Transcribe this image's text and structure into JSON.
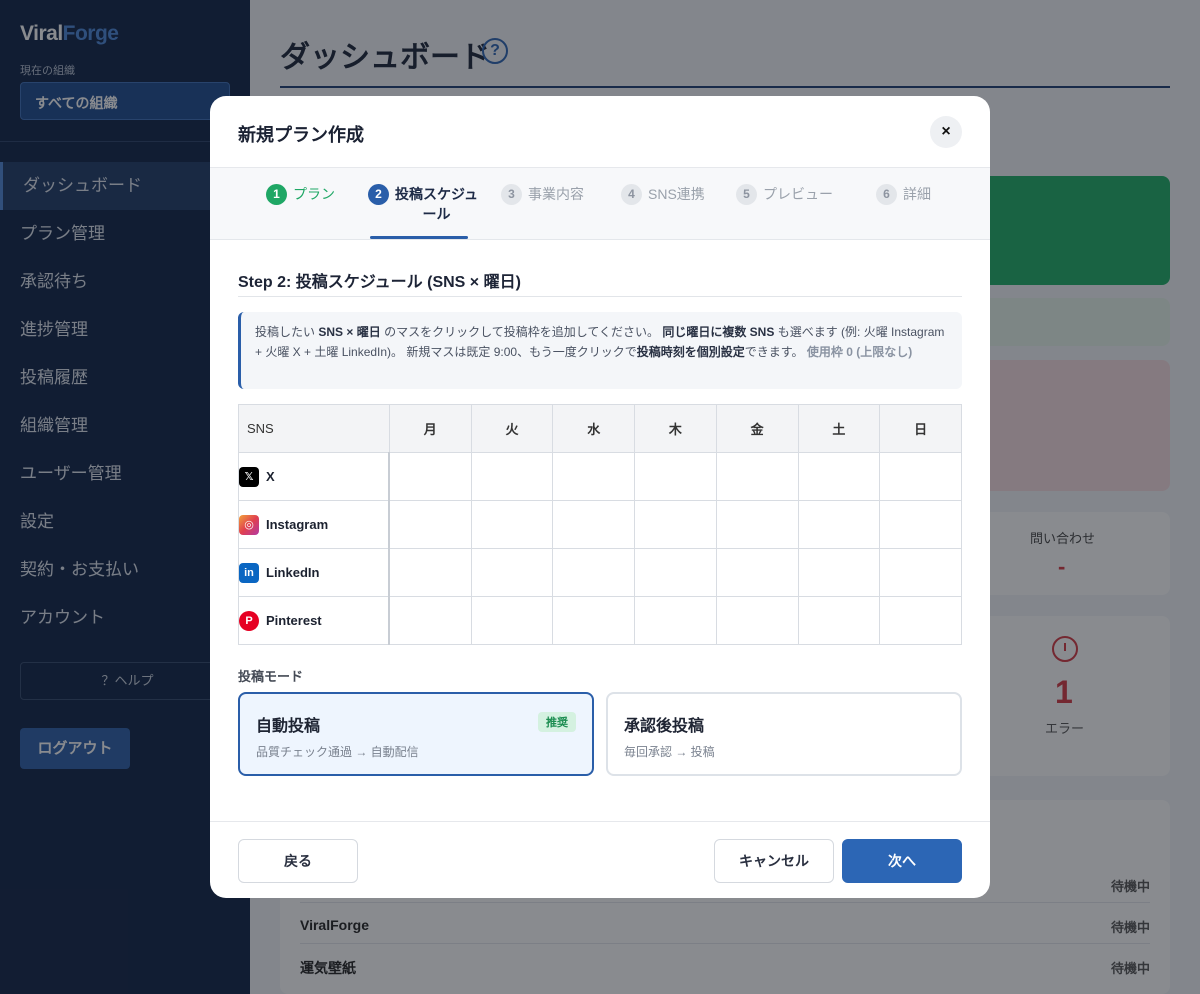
{
  "sidebar": {
    "logo_part1": "Viral",
    "logo_part2": "Forge",
    "org_label": "現在の組織",
    "org_value": "すべての組織",
    "items": [
      {
        "label": "ダッシュボード"
      },
      {
        "label": "プラン管理"
      },
      {
        "label": "承認待ち"
      },
      {
        "label": "進捗管理"
      },
      {
        "label": "投稿履歴"
      },
      {
        "label": "組織管理"
      },
      {
        "label": "ユーザー管理"
      },
      {
        "label": "設定"
      },
      {
        "label": "契約・お支払い"
      },
      {
        "label": "アカウント"
      }
    ],
    "help": "？ヘルプ",
    "logout": "ログアウト"
  },
  "main": {
    "title": "ダッシュボード",
    "help_icon": "?",
    "inquiry_label": "問い合わせ",
    "inquiry_value": "-",
    "error_count": "1",
    "error_label": "エラー",
    "rows": [
      {
        "name": "",
        "status": "待機中"
      },
      {
        "name": "ViralForge",
        "status": "待機中"
      },
      {
        "name": "運気壁紙",
        "status": "待機中"
      }
    ]
  },
  "modal": {
    "title": "新規プラン作成",
    "close": "×",
    "steps": [
      {
        "num": "1",
        "label": "プラン"
      },
      {
        "num": "2",
        "label": "投稿スケジュ",
        "label2": "ール"
      },
      {
        "num": "3",
        "label": "事業内容"
      },
      {
        "num": "4",
        "label": "SNS連携"
      },
      {
        "num": "5",
        "label": "プレビュー"
      },
      {
        "num": "6",
        "label": "詳細"
      }
    ],
    "heading": "Step 2: 投稿スケジュール (SNS × 曜日)",
    "info": {
      "p1": "投稿したい",
      "p2": "SNS × 曜日",
      "p3": "のマスをクリックして投稿枠を追加してください。",
      "p4": "同じ曜日に複数 SNS",
      "p5": "も選べます (例: 火曜 Instagram + 火曜 X + 土曜 LinkedIn)。 新規マスは既定 9:00、もう一度クリックで",
      "p6": "投稿時刻を個別設定",
      "p7": "できます。",
      "p8": "使用枠 0 (上限なし)"
    },
    "grid": {
      "sns_header": "SNS",
      "days": [
        "月",
        "火",
        "水",
        "木",
        "金",
        "土",
        "日"
      ],
      "rows": [
        {
          "name": "X",
          "icon": "x-icon"
        },
        {
          "name": "Instagram",
          "icon": "instagram-icon"
        },
        {
          "name": "LinkedIn",
          "icon": "linkedin-icon"
        },
        {
          "name": "Pinterest",
          "icon": "pinterest-icon"
        }
      ]
    },
    "mode": {
      "label": "投稿モード",
      "auto": {
        "title": "自動投稿",
        "desc": "品質チェック通過 → 自動配信",
        "badge": "推奨"
      },
      "approval": {
        "title": "承認後投稿",
        "desc": "毎回承認 → 投稿"
      }
    },
    "footer": {
      "back": "戻る",
      "cancel": "キャンセル",
      "next": "次へ"
    }
  }
}
